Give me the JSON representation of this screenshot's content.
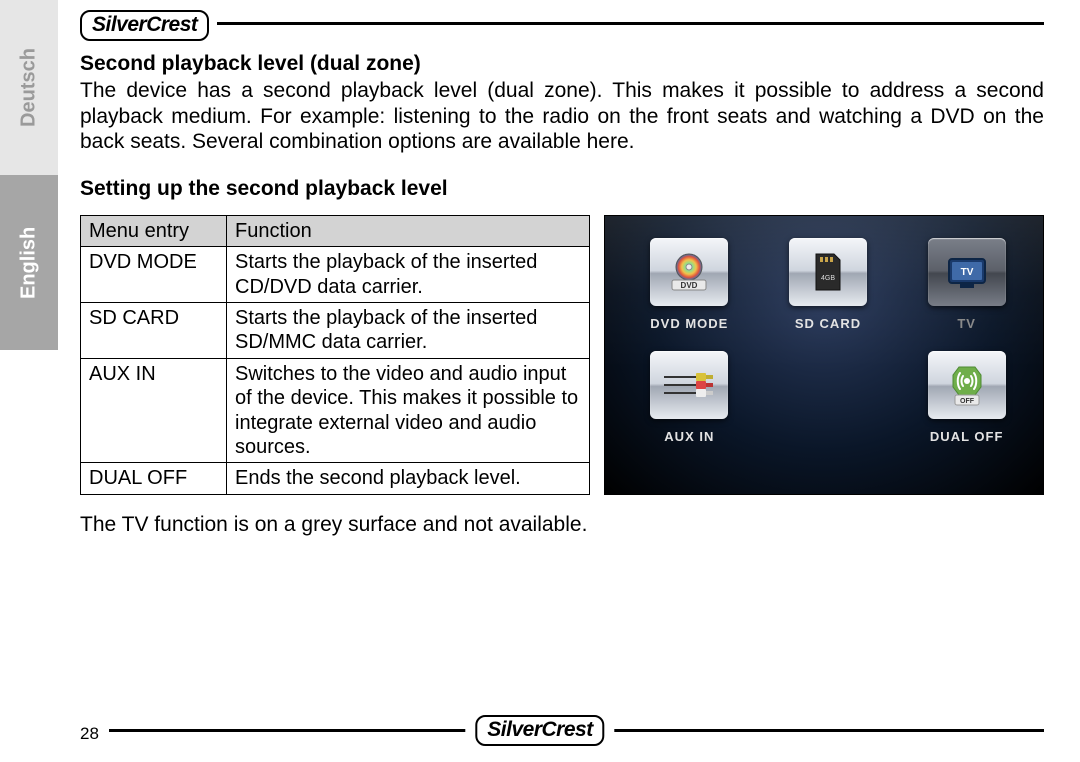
{
  "lang_tabs": {
    "deutsch": "Deutsch",
    "english": "English"
  },
  "brand": "SilverCrest",
  "page_number": "28",
  "section1": {
    "heading": "Second playback level (dual zone)",
    "body": "The device has a second playback level (dual zone). This makes it possible to address a second playback medium. For example: listening to the radio on the front seats and watching a DVD on the back seats. Several combination options are available here."
  },
  "section2": {
    "heading": "Setting up the second playback level"
  },
  "table": {
    "headers": {
      "col1": "Menu entry",
      "col2": "Function"
    },
    "rows": [
      {
        "entry": "DVD MODE",
        "func": "Starts the playback of the inserted CD/DVD data carrier."
      },
      {
        "entry": "SD CARD",
        "func": "Starts the playback of the inserted SD/MMC data carrier."
      },
      {
        "entry": "AUX IN",
        "func": "Switches to the video and audio input of the device. This makes it possible to integrate external video and audio sources."
      },
      {
        "entry": "DUAL OFF",
        "func": "Ends the second playback level."
      }
    ]
  },
  "screen_items": [
    {
      "label": "DVD MODE",
      "icon": "dvd-icon"
    },
    {
      "label": "SD CARD",
      "icon": "sdcard-icon"
    },
    {
      "label": "TV",
      "icon": "tv-icon",
      "unavailable": true
    },
    {
      "label": "AUX IN",
      "icon": "aux-icon"
    },
    {
      "label": "DUAL OFF",
      "icon": "dualoff-icon"
    }
  ],
  "note": "The TV function is on a grey surface and not available."
}
